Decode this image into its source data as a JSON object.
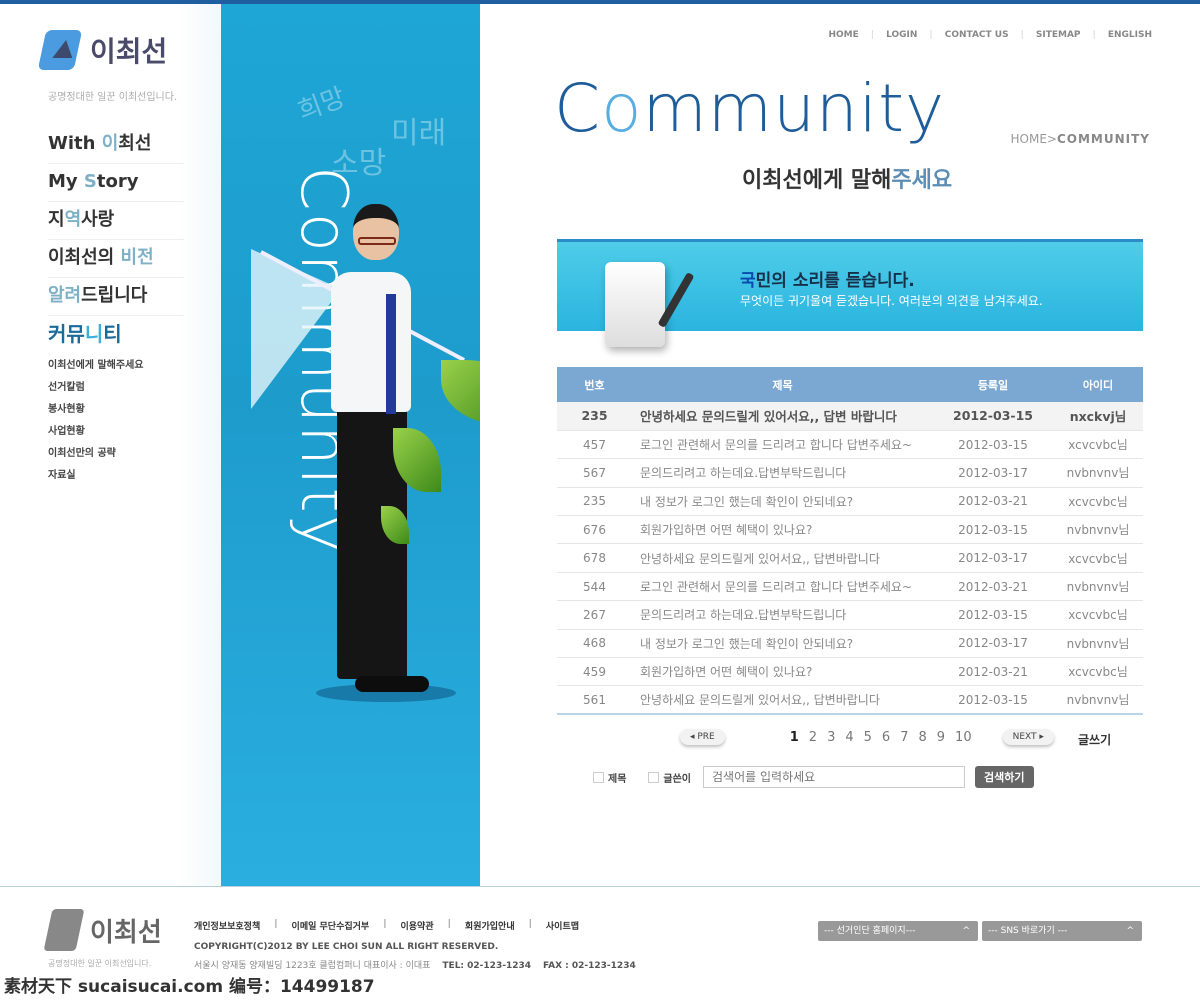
{
  "brand": {
    "name": "이최선",
    "slogan": "공명정대한 일꾼 이최선입니다."
  },
  "main_nav": [
    {
      "pre": "With ",
      "hl": "이",
      "post": "최선"
    },
    {
      "pre": "My ",
      "hl": "S",
      "post": "tory"
    },
    {
      "pre": "지",
      "hl": "역",
      "post": "사랑"
    },
    {
      "pre": "이최선의 ",
      "hl": "비전",
      "post": ""
    },
    {
      "pre": "",
      "hl": "알려",
      "post": "드립니다"
    },
    {
      "pre": "커뮤",
      "hl": "니",
      "post": "티"
    }
  ],
  "sub_nav": [
    "이최선에게 말해주세요",
    "선거칼럼",
    "봉사현황",
    "사업현황",
    "이최선만의 공략",
    "자료실"
  ],
  "visual": {
    "vertical_text": "Community",
    "words": [
      "희망",
      "미래",
      "소망"
    ]
  },
  "top_nav": [
    "HOME",
    "LOGIN",
    "CONTACT US",
    "SITEMAP",
    "ENGLISH"
  ],
  "page": {
    "title_pre": "C",
    "title_o": "o",
    "title_post": "mmunity",
    "breadcrumb_home": "HOME>",
    "breadcrumb_current": "COMMUNITY",
    "subtitle_a": "이최선에게 말해",
    "subtitle_b": "주세요"
  },
  "banner": {
    "title_hl": "국",
    "title": "민의 소리를 듣습니다.",
    "text": "무엇이든 귀기울여 듣겠습니다. 여러분의 의견을 남겨주세요."
  },
  "table": {
    "headers": [
      "번호",
      "제목",
      "등록일",
      "아이디"
    ],
    "rows": [
      [
        "235",
        "안녕하세요 문의드릴게 있어서요,, 답변 바랍니다",
        "2012-03-15",
        "nxckvj님"
      ],
      [
        "457",
        "로그인 관련해서 문의를 드리려고 합니다 답변주세요~",
        "2012-03-15",
        "xcvcvbc님"
      ],
      [
        "567",
        "문의드리려고 하는데요.답변부탁드립니다",
        "2012-03-17",
        "nvbnvnv님"
      ],
      [
        "235",
        "내 정보가 로그인 했는데 확인이 안되네요?",
        "2012-03-21",
        "xcvcvbc님"
      ],
      [
        "676",
        "회원가입하면 어떤 혜택이 있나요?",
        "2012-03-15",
        "nvbnvnv님"
      ],
      [
        "678",
        "안녕하세요 문의드릴게 있어서요,, 답변바랍니다",
        "2012-03-17",
        "xcvcvbc님"
      ],
      [
        "544",
        "로그인 관련해서 문의를 드리려고 합니다 답변주세요~",
        "2012-03-21",
        "nvbnvnv님"
      ],
      [
        "267",
        "문의드리려고 하는데요.답변부탁드립니다",
        "2012-03-15",
        "xcvcvbc님"
      ],
      [
        "468",
        "내 정보가 로그인 했는데 확인이 안되네요?",
        "2012-03-17",
        "nvbnvnv님"
      ],
      [
        "459",
        "회원가입하면 어떤 혜택이 있나요?",
        "2012-03-21",
        "xcvcvbc님"
      ],
      [
        "561",
        "안녕하세요 문의드릴게 있어서요,, 답변바랍니다",
        "2012-03-15",
        "nvbnvnv님"
      ]
    ]
  },
  "pager": {
    "prev": "◂ PRE",
    "next": "NEXT ▸",
    "pages": [
      "1",
      "2",
      "3",
      "4",
      "5",
      "6",
      "7",
      "8",
      "9",
      "10"
    ],
    "current": "1",
    "write": "글쓰기"
  },
  "search": {
    "opt1": "제목",
    "opt2": "글쓴이",
    "placeholder": "검색어를 입력하세요",
    "button": "검색하기"
  },
  "footer": {
    "links": [
      "개인정보보호정책",
      "이메일 무단수집거부",
      "이용약관",
      "회원가입안내",
      "사이트맵"
    ],
    "copyright": "COPYRIGHT(C)2012 BY LEE CHOI SUN ALL RIGHT RESERVED.",
    "address": "서울시 양재동 양재빌딩 1223호 클럽컴퍼니  대표이사 : 이대표",
    "tel": "TEL: 02-123-1234",
    "fax": "FAX : 02-123-1234",
    "select1": "--- 선거인단 홈페이지---",
    "select2": "--- SNS 바로가기 ---"
  },
  "watermark": "素材天下 sucaisucai.com  编号：14499187"
}
